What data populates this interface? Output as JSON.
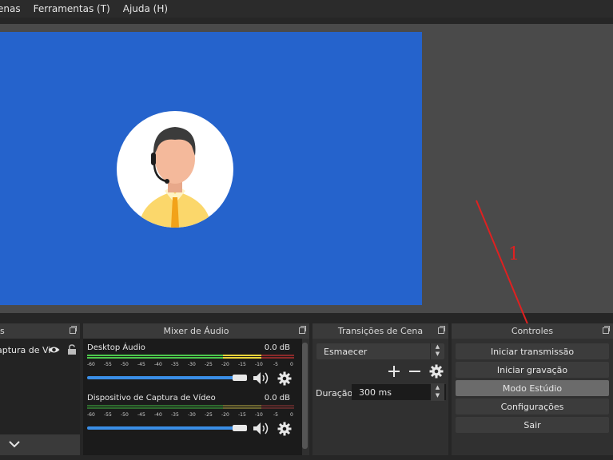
{
  "menu": {
    "items": [
      "enas",
      "Ferramentas (T)",
      "Ajuda (H)"
    ]
  },
  "sources": {
    "title": "s",
    "item_label": "aptura de Vi"
  },
  "mixer": {
    "title": "Mixer de Áudio",
    "scale": [
      "-60",
      "-55",
      "-50",
      "-45",
      "-40",
      "-35",
      "-30",
      "-25",
      "-20",
      "-15",
      "-10",
      "-5",
      "0"
    ],
    "tracks": [
      {
        "name": "Desktop Áudio",
        "db": "0.0 dB",
        "volume": 1.0
      },
      {
        "name": "Dispositivo de Captura de Vídeo",
        "db": "0.0 dB",
        "volume": 1.0
      }
    ]
  },
  "transitions": {
    "title": "Transições de Cena",
    "selected": "Esmaecer",
    "duration_label": "Duração",
    "duration_value": "300 ms"
  },
  "controls": {
    "title": "Controles",
    "buttons": [
      "Iniciar transmissão",
      "Iniciar gravação",
      "Modo Estúdio",
      "Configurações",
      "Sair"
    ]
  },
  "annotation": {
    "number": "1",
    "color": "#e02020"
  },
  "colors": {
    "preview_bg": "#2563cc",
    "accent_blue": "#3a8ee6",
    "meter_green": "#4cc84c",
    "meter_yellow": "#e8d43a",
    "meter_red": "#d84040"
  }
}
